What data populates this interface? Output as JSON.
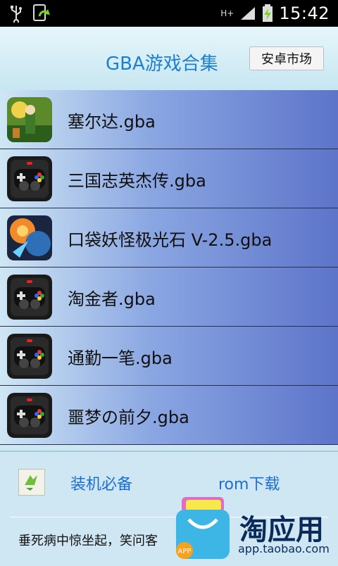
{
  "status_bar": {
    "time": "15:42",
    "network": "H+",
    "icons": [
      "usb-icon",
      "update-icon",
      "signal-icon",
      "battery-charging-icon"
    ]
  },
  "header": {
    "title": "GBA游戏合集",
    "market_button": "安卓市场"
  },
  "games": [
    {
      "name": "塞尔达.gba",
      "icon": "zelda-art-icon"
    },
    {
      "name": "三国志英杰传.gba",
      "icon": "gamepad-icon"
    },
    {
      "name": "口袋妖怪极光石 V-2.5.gba",
      "icon": "pokemon-art-icon"
    },
    {
      "name": "淘金者.gba",
      "icon": "gamepad-icon"
    },
    {
      "name": "通勤一笔.gba",
      "icon": "gamepad-icon"
    },
    {
      "name": "噩梦の前夕.gba",
      "icon": "gamepad-icon"
    }
  ],
  "footer": {
    "essential": "装机必备",
    "rom_download": "rom下载",
    "ad_text": "垂死病中惊坐起，笑问客",
    "taobao_name": "淘应用",
    "taobao_url": "app.taobao.com",
    "bag_label": "APP"
  }
}
